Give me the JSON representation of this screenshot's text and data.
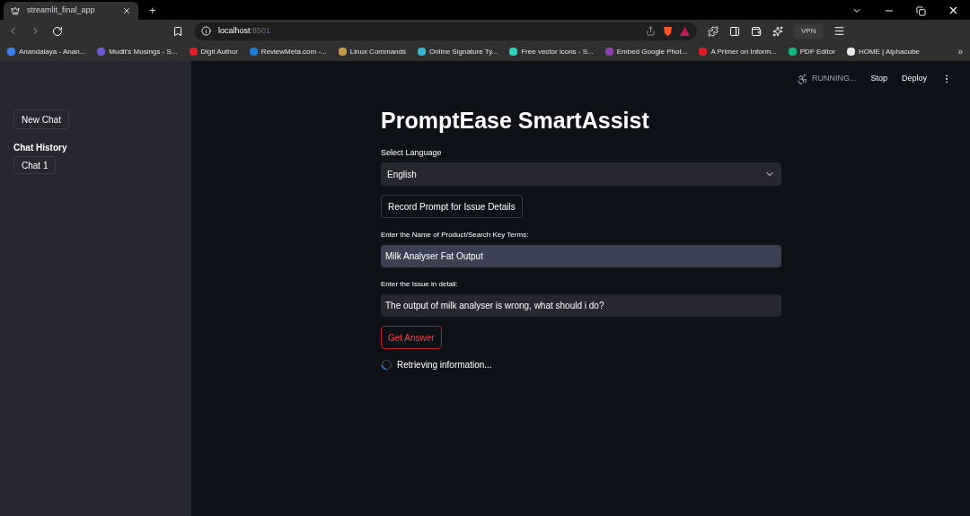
{
  "browser": {
    "tab_title": "streamlit_final_app",
    "new_tab": "+",
    "address_host": "localhost",
    "address_port": ":8501",
    "vpn": "VPN",
    "bookmarks": [
      {
        "label": "Anandalaya - Anan...",
        "color": "#3b82f6"
      },
      {
        "label": "Mudit's Musings - S...",
        "color": "#6d5bd0"
      },
      {
        "label": "Digit Author",
        "color": "#e11d2a"
      },
      {
        "label": "ReviewMeta.com -...",
        "color": "#1e7fd8"
      },
      {
        "label": "Linux Commands",
        "color": "#c89a4a"
      },
      {
        "label": "Online Signature Ty...",
        "color": "#38b6d0"
      },
      {
        "label": "Free vector icons - S...",
        "color": "#2dd4bf"
      },
      {
        "label": "Embed Google Phot...",
        "color": "#8b3fa8"
      },
      {
        "label": "A Primer on Inform...",
        "color": "#e11d2a"
      },
      {
        "label": "PDF Editor",
        "color": "#10b981"
      },
      {
        "label": "HOME | Alphacube",
        "color": "#e5e7eb"
      }
    ],
    "more": "»"
  },
  "sidebar": {
    "new_chat": "New Chat",
    "history_title": "Chat History",
    "chats": [
      {
        "label": "Chat 1"
      }
    ]
  },
  "header": {
    "status": "RUNNING...",
    "stop": "Stop",
    "deploy": "Deploy"
  },
  "main": {
    "title": "PromptEase SmartAssist",
    "language": {
      "label": "Select Language",
      "value": "English"
    },
    "record_button": "Record Prompt for Issue Details",
    "fields": [
      {
        "label": "Enter the Name of Product/Search Key Terms:",
        "value": "Milk Analyser Fat Output",
        "focused": true
      },
      {
        "label": "Enter the Issue in detail:",
        "value": "The output of milk analyser is wrong, what should i do?",
        "focused": false
      }
    ],
    "answer_button": {
      "label": "Get Answer",
      "focused": true
    },
    "spinner": "Retrieving information..."
  }
}
